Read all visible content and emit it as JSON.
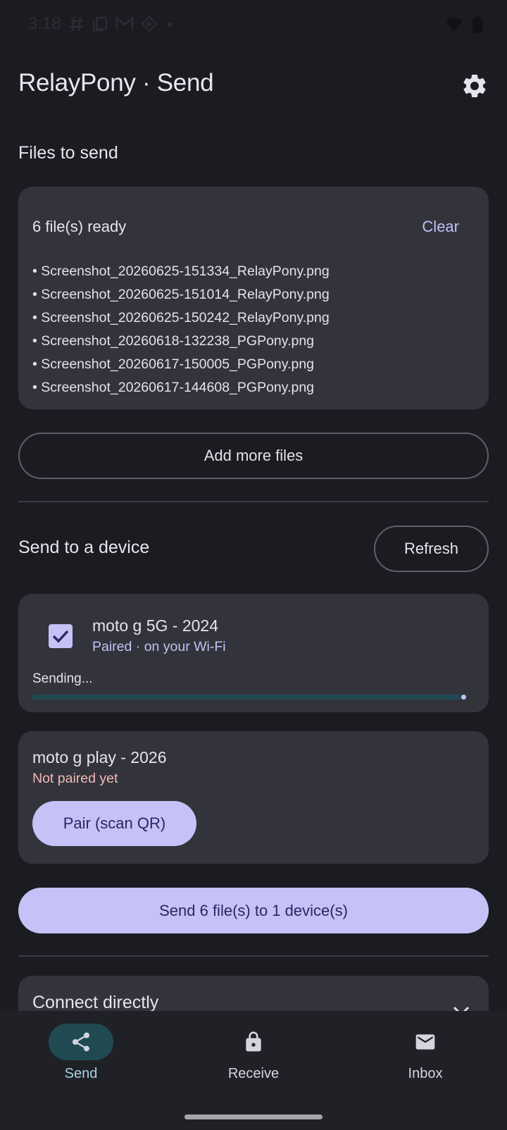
{
  "status_bar": {
    "time": "3:18",
    "left_icons": [
      "hash-icon",
      "copy-icon",
      "gmail-icon",
      "diamond-icon",
      "dot-icon"
    ],
    "right_icons": [
      "wifi-icon",
      "battery-icon"
    ]
  },
  "header": {
    "title": "RelayPony · Send",
    "settings_icon": "gear-icon"
  },
  "files_section": {
    "title": "Files to send",
    "count_label": "6 file(s) ready",
    "clear_label": "Clear",
    "files": [
      "• Screenshot_20260625-151334_RelayPony.png",
      "• Screenshot_20260625-151014_RelayPony.png",
      "• Screenshot_20260625-150242_RelayPony.png",
      "• Screenshot_20260618-132238_PGPony.png",
      "• Screenshot_20260617-150005_PGPony.png",
      "• Screenshot_20260617-144608_PGPony.png"
    ],
    "add_more_label": "Add more files"
  },
  "devices_section": {
    "title": "Send to a device",
    "refresh_label": "Refresh",
    "devices": [
      {
        "name": "moto g 5G - 2024",
        "status": "Paired · on your Wi-Fi",
        "status_color": "#c3c0f6",
        "checked": true,
        "progress_label": "Sending...",
        "progress": 1.0
      },
      {
        "name": "moto g play - 2026",
        "status": "Not paired yet",
        "status_color": "#f2b8b5",
        "pair_label": "Pair (scan QR)"
      }
    ],
    "send_label": "Send 6 file(s) to 1 device(s)"
  },
  "connect_section": {
    "title": "Connect directly"
  },
  "bottom_nav": {
    "items": [
      {
        "label": "Send",
        "icon": "share-icon",
        "active": true
      },
      {
        "label": "Receive",
        "icon": "lock-icon",
        "active": false
      },
      {
        "label": "Inbox",
        "icon": "mail-icon",
        "active": false
      }
    ]
  },
  "colors": {
    "background": "#1b1c22",
    "card": "#33333b",
    "accent": "#c5c2f7",
    "accent_text": "#2a2761",
    "progress_track": "#1f4a52",
    "error_text": "#f2b8b5"
  }
}
